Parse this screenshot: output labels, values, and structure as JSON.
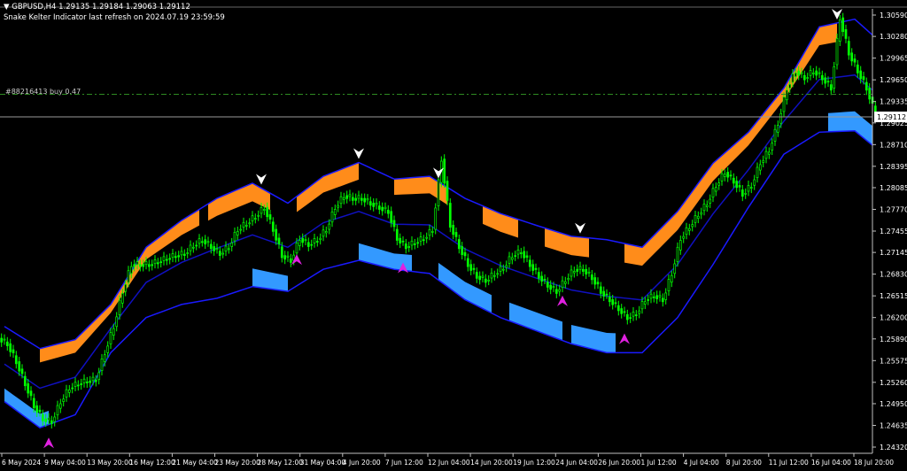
{
  "header": {
    "symbol_line": "GBPUSD,H4  1.29135 1.29184 1.29063 1.29112",
    "indicator_line": "Snake Kelter Indicator last refresh on 2024.07.19 23:59:59"
  },
  "position": {
    "label": "#88216413 buy 0.47",
    "price": 1.2944,
    "color": "#2e8b22"
  },
  "chart_data": {
    "type": "candlestick",
    "symbol": "GBPUSD",
    "timeframe": "H4",
    "ylim": [
      1.2432,
      1.3059
    ],
    "y_ticks": [
      "1.30590",
      "1.30280",
      "1.29965",
      "1.29650",
      "1.29335",
      "1.29025",
      "1.28710",
      "1.28395",
      "1.28085",
      "1.27770",
      "1.27455",
      "1.27145",
      "1.26830",
      "1.26515",
      "1.26200",
      "1.25890",
      "1.25575",
      "1.25260",
      "1.24950",
      "1.24635",
      "1.24320"
    ],
    "x_ticks": [
      "6 May 2024",
      "9 May 04:00",
      "13 May 20:00",
      "16 May 12:00",
      "21 May 04:00",
      "23 May 20:00",
      "28 May 12:00",
      "31 May 04:00",
      "4 Jun 20:00",
      "7 Jun 12:00",
      "12 Jun 04:00",
      "14 Jun 20:00",
      "19 Jun 12:00",
      "24 Jun 04:00",
      "26 Jun 20:00",
      "1 Jul 12:00",
      "4 Jul 04:00",
      "8 Jul 20:00",
      "11 Jul 12:00",
      "16 Jul 04:00",
      "18 Jul 20:00"
    ],
    "bid": {
      "value": 1.29112,
      "label": "1.29112"
    },
    "closes": [
      1.2582,
      1.2556,
      1.2524,
      1.2492,
      1.2473,
      1.2469,
      1.2498,
      1.2518,
      1.2524,
      1.2528,
      1.253,
      1.2569,
      1.2607,
      1.2658,
      1.2697,
      1.2697,
      1.2697,
      1.2701,
      1.2706,
      1.271,
      1.2713,
      1.2725,
      1.2733,
      1.2723,
      1.2713,
      1.2723,
      1.2748,
      1.2757,
      1.2767,
      1.278,
      1.2748,
      1.271,
      1.2703,
      1.2735,
      1.2726,
      1.2733,
      1.2748,
      1.278,
      1.2797,
      1.2793,
      1.2793,
      1.2786,
      1.278,
      1.2774,
      1.2735,
      1.2723,
      1.2729,
      1.2735,
      1.2748,
      1.285,
      1.2754,
      1.2723,
      1.2697,
      1.268,
      1.2674,
      1.2684,
      1.2693,
      1.271,
      1.2716,
      1.2697,
      1.268,
      1.2667,
      1.2658,
      1.2675,
      1.269,
      1.269,
      1.2678,
      1.2658,
      1.2646,
      1.2633,
      1.262,
      1.2626,
      1.2646,
      1.2652,
      1.2646,
      1.2684,
      1.2735,
      1.2752,
      1.277,
      1.2786,
      1.2812,
      1.2831,
      1.2818,
      1.2799,
      1.2812,
      1.2845,
      1.2863,
      1.2902,
      1.2953,
      1.2978,
      1.2968,
      1.2978,
      1.2968,
      1.2953,
      1.3055,
      1.3004,
      1.2978,
      1.2953,
      1.2914
    ],
    "band_index": [
      0,
      4,
      8,
      12,
      16,
      20,
      24,
      28,
      32,
      36,
      40,
      44,
      48,
      52,
      56,
      60,
      64,
      68,
      72,
      76,
      80,
      84,
      88,
      92,
      96,
      98
    ],
    "upper_band": [
      1.2607,
      1.2575,
      1.2588,
      1.2639,
      1.2722,
      1.2761,
      1.2793,
      1.2815,
      1.2786,
      1.2825,
      1.2845,
      1.2821,
      1.2825,
      1.2793,
      1.2771,
      1.2754,
      1.2738,
      1.2733,
      1.2722,
      1.2774,
      1.2844,
      1.2889,
      1.2953,
      1.3042,
      1.3053,
      1.303
    ],
    "lower_band": [
      1.2498,
      1.246,
      1.2479,
      1.2569,
      1.262,
      1.2639,
      1.2648,
      1.2665,
      1.2658,
      1.269,
      1.2703,
      1.269,
      1.2684,
      1.2646,
      1.262,
      1.2601,
      1.2582,
      1.2569,
      1.2569,
      1.262,
      1.2697,
      1.278,
      1.2857,
      1.2889,
      1.2891,
      1.287
    ],
    "orange_ranges": [
      [
        4,
        22
      ],
      [
        23,
        30
      ],
      [
        33,
        40
      ],
      [
        44,
        50
      ],
      [
        54,
        58
      ],
      [
        61,
        66
      ],
      [
        70,
        94
      ]
    ],
    "blue_ranges": [
      [
        0,
        5
      ],
      [
        28,
        32
      ],
      [
        40,
        46
      ],
      [
        49,
        55
      ],
      [
        57,
        63
      ],
      [
        64,
        69
      ],
      [
        93,
        98
      ]
    ],
    "sell_arrows": [
      29,
      40,
      49,
      65,
      94
    ],
    "buy_arrows": [
      5,
      33,
      45,
      63,
      70
    ],
    "colors": {
      "candle": "#00ff00",
      "band": "#1a1aff",
      "mid": "#1010c0",
      "orange": "#ff8c1a",
      "blue": "#3399ff",
      "sell_arrow": "#ffffff",
      "buy_arrow": "#e020e0",
      "grid": "#c0c0c0"
    }
  }
}
